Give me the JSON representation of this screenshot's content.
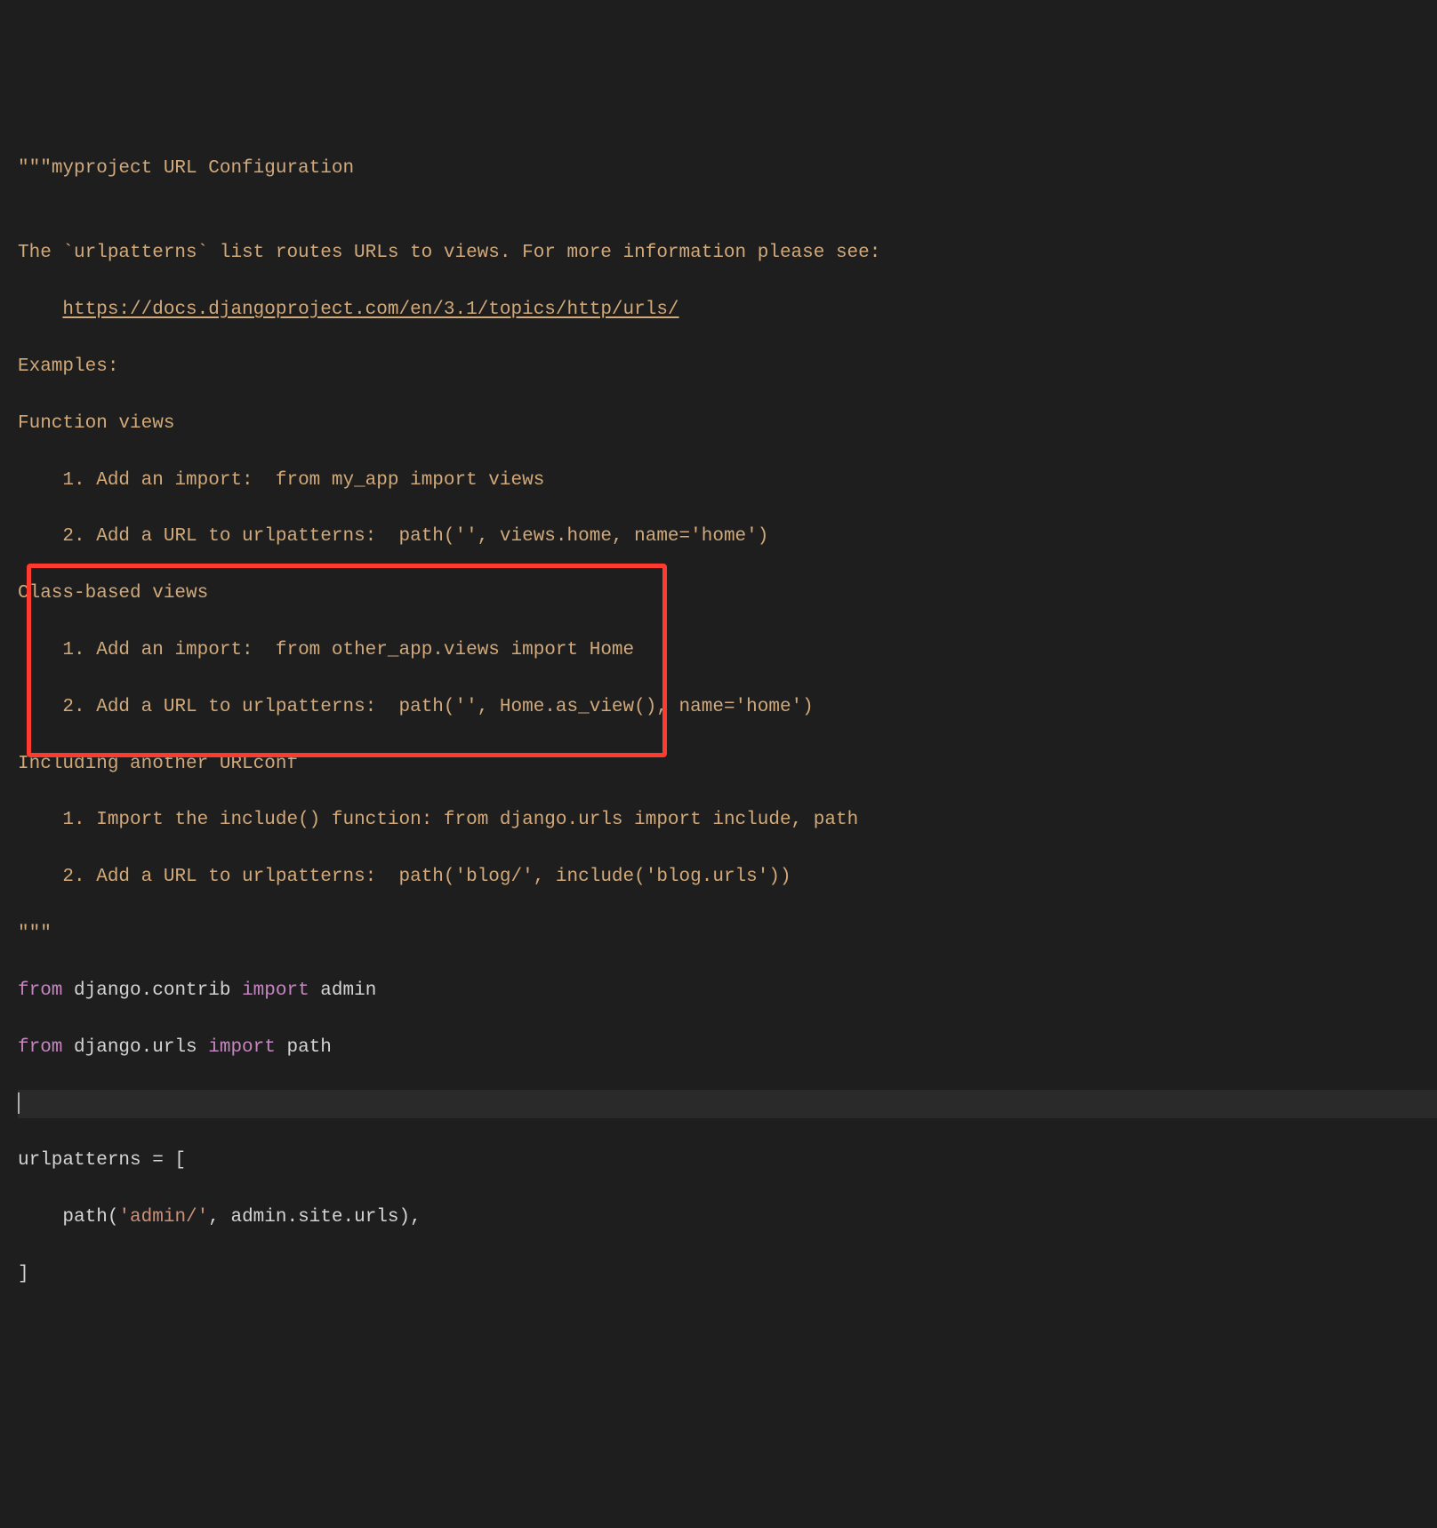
{
  "editor": {
    "lines": {
      "l1_quote": "\"\"\"",
      "l1_text": "myproject URL Configuration",
      "l2_blank": "",
      "l3_text": "The `urlpatterns` list routes URLs to views. For more information please see:",
      "l4_indent": "    ",
      "l4_url": "https://docs.djangoproject.com/en/3.1/topics/http/urls/",
      "l5_text": "Examples:",
      "l6_text": "Function views",
      "l7_indent": "    ",
      "l7_text": "1. Add an import:  from my_app import views",
      "l8_indent": "    ",
      "l8_text": "2. Add a URL to urlpatterns:  path('', views.home, name='home')",
      "l9_text": "Class-based views",
      "l10_indent": "    ",
      "l10_text": "1. Add an import:  from other_app.views import Home",
      "l11_indent": "    ",
      "l11_text": "2. Add a URL to urlpatterns:  path('', Home.as_view(), name='home')",
      "l12_text": "Including another URLconf",
      "l13_indent": "    ",
      "l13_text": "1. Import the include() function: from django.urls import include, path",
      "l14_indent": "    ",
      "l14_text": "2. Add a URL to urlpatterns:  path('blog/', include('blog.urls'))",
      "l15_quote": "\"\"\"",
      "l16_from": "from",
      "l16_mod": " django.contrib ",
      "l16_import": "import",
      "l16_name": " admin",
      "l17_from": "from",
      "l17_mod": " django.urls ",
      "l17_import": "import",
      "l17_name": " path",
      "l18_blank": "",
      "l19_text": "urlpatterns = [",
      "l20_indent": "    ",
      "l20_func": "path(",
      "l20_str": "'admin/'",
      "l20_rest": ", admin.site.urls),",
      "l21_text": "]"
    }
  },
  "annotation": {
    "box": "highlighted-code-region"
  }
}
